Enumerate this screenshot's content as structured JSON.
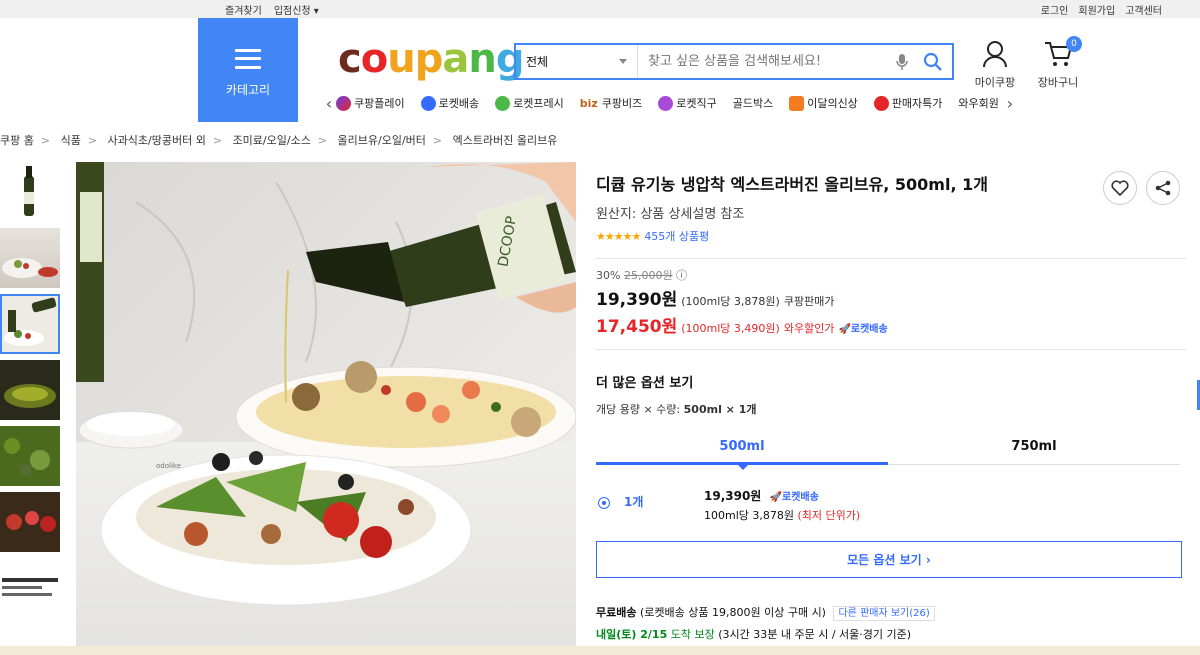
{
  "topbar": {
    "left": [
      "즐겨찾기",
      "입점신청 ▾"
    ],
    "right": [
      "로그인",
      "회원가입",
      "고객센터"
    ]
  },
  "category_label": "카테고리",
  "logo": {
    "c": "c",
    "o1": "o",
    "u": "u",
    "p": "p",
    "a": "a",
    "n": "n",
    "g": "g"
  },
  "search": {
    "scope": "전체",
    "placeholder": "찾고 싶은 상품을 검색해보세요!"
  },
  "my_coupang": "마이쿠팡",
  "cart": {
    "label": "장바구니",
    "count": "0"
  },
  "quick_menu": [
    "쿠팡플레이",
    "로켓배송",
    "로켓프레시",
    "쿠팡비즈",
    "로켓직구",
    "골드박스",
    "이달의신상",
    "판매자특가",
    "와우회원"
  ],
  "biz_prefix": "biz",
  "breadcrumb": [
    "쿠팡 홈",
    "식품",
    "사과식초/땅콩버터 외",
    "조미료/오일/소스",
    "올리브유/오일/버터",
    "엑스트라버진 올리브유"
  ],
  "product": {
    "title": "디큡 유기농 냉압착 엑스트라버진 올리브유, 500ml, 1개",
    "origin": "원산지: 상품 상세설명 참조",
    "stars": "★★★★★",
    "reviews": "455개 상품평",
    "discount_rate": "30%",
    "original_price": "25,000원",
    "info_icon": "ⓘ",
    "price": "19,390원",
    "price_unit": "(100ml당 3,878원)",
    "price_label": "쿠팡판매가",
    "wow_price": "17,450원",
    "wow_unit": "(100ml당 3,490원)",
    "wow_label": "와우할인가",
    "rocket": "로켓배송"
  },
  "options": {
    "title": "더 많은 옵션 보기",
    "sub_prefix": "개당 용량 × 수량: ",
    "sub_value": "500ml × 1개",
    "tabs": [
      "500ml",
      "750ml"
    ],
    "row": {
      "qty": "1개",
      "price": "19,390원",
      "rocket": "로켓배송",
      "unit": "100ml당 3,878원",
      "lowest": "(최저 단위가)"
    },
    "all_button": "모든 옵션 보기 ›"
  },
  "shipping": {
    "free": "무료배송",
    "free_desc": "(로켓배송 상품 19,800원 이상 구매 시)",
    "other_sellers": "다른 판매자 보기(26)",
    "arrive": "내일(토) 2/15",
    "arrive_tail": "도착 보장",
    "arrive_cond": "(3시간 33분  내 주문 시 / 서울·경기 기준)"
  },
  "image_labels": {
    "bottle_brand": "DCOOP",
    "bowl_brand": "odolike"
  },
  "colors": {
    "accent": "#346aff",
    "category": "#4285f4",
    "sale": "#e52528",
    "arrive": "#00891a"
  }
}
